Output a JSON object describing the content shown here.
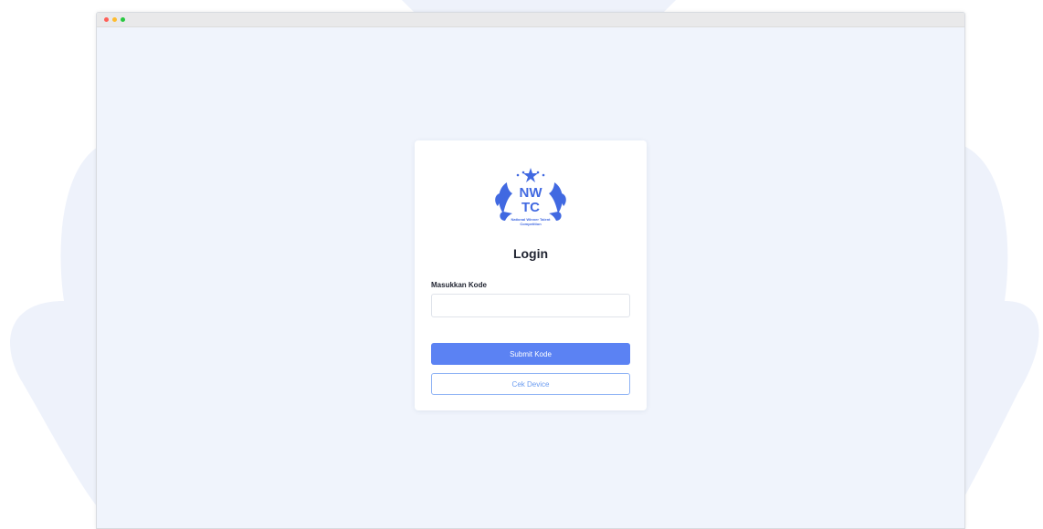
{
  "window": {
    "controls": [
      "close",
      "minimize",
      "maximize"
    ]
  },
  "logo": {
    "mark": "NW TC",
    "caption_line1": "National Winner Talent",
    "caption_line2": "Competition"
  },
  "login": {
    "title": "Login",
    "code_label": "Masukkan Kode",
    "code_value": "",
    "code_placeholder": "",
    "submit_label": "Submit Kode",
    "check_device_label": "Cek Device"
  },
  "colors": {
    "accent": "#5b82f3",
    "logo_blue": "#4169e1",
    "window_bg": "#f0f4fc",
    "dot_red": "#ff5f57",
    "dot_yellow": "#febc2e",
    "dot_green": "#28c840"
  }
}
